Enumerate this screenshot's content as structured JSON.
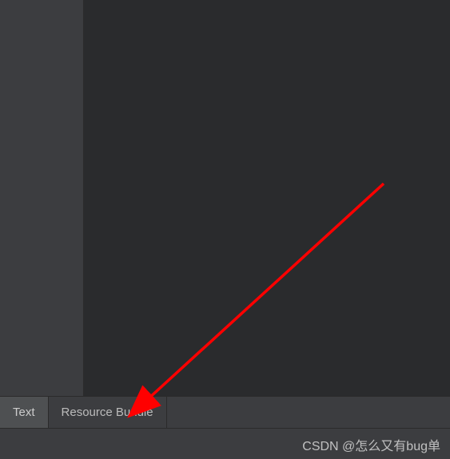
{
  "tabs": [
    {
      "label": "Text",
      "active": true
    },
    {
      "label": "Resource Bundle",
      "active": false
    }
  ],
  "watermark": "CSDN @怎么又有bug单"
}
